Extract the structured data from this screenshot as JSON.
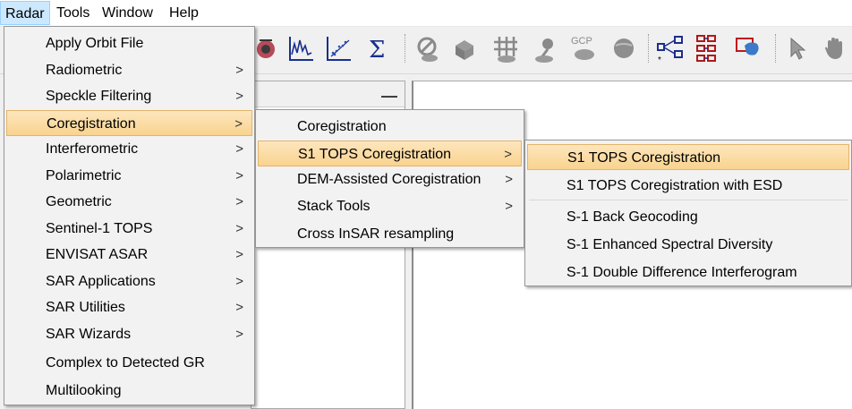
{
  "menubar": {
    "items": [
      {
        "label": "Radar"
      },
      {
        "label": "Tools"
      },
      {
        "label": "Window"
      },
      {
        "label": "Help"
      }
    ]
  },
  "toolbar": {
    "gcp_text": "GCP",
    "tools": [
      "radar-sat-icon",
      "spectrum-plot-icon",
      "scatter-plot-icon",
      "sum-icon",
      "no-entry-icon",
      "cube-open-icon",
      "grid-icon",
      "pin-icon",
      "gcp-icon",
      "globe-icon",
      "graph-builder-icon",
      "batch-processing-icon",
      "world-map-icon",
      "pointer-icon",
      "pan-hand-icon"
    ]
  },
  "radar_menu": {
    "items": [
      {
        "label": "Apply Orbit File",
        "submenu": false
      },
      {
        "label": "Radiometric",
        "submenu": true
      },
      {
        "label": "Speckle Filtering",
        "submenu": true
      },
      {
        "label": "Coregistration",
        "submenu": true
      },
      {
        "label": "Interferometric",
        "submenu": true
      },
      {
        "label": "Polarimetric",
        "submenu": true
      },
      {
        "label": "Geometric",
        "submenu": true
      },
      {
        "label": "Sentinel-1 TOPS",
        "submenu": true
      },
      {
        "label": "ENVISAT ASAR",
        "submenu": true
      },
      {
        "label": "SAR Applications",
        "submenu": true
      },
      {
        "label": "SAR Utilities",
        "submenu": true
      },
      {
        "label": "SAR Wizards",
        "submenu": true
      },
      {
        "label": "Complex to Detected GR",
        "submenu": false
      },
      {
        "label": "Multilooking",
        "submenu": false
      }
    ]
  },
  "coreg_menu": {
    "items": [
      {
        "label": "Coregistration",
        "submenu": false
      },
      {
        "label": "S1 TOPS Coregistration",
        "submenu": true
      },
      {
        "label": "DEM-Assisted Coregistration",
        "submenu": true
      },
      {
        "label": "Stack Tools",
        "submenu": true
      },
      {
        "label": "Cross InSAR resampling",
        "submenu": false
      }
    ]
  },
  "s1tops_menu": {
    "items": [
      {
        "label": "S1 TOPS Coregistration"
      },
      {
        "label": "S1 TOPS Coregistration with ESD"
      },
      {
        "label": "S-1 Back Geocoding"
      },
      {
        "label": "S-1 Enhanced Spectral Diversity"
      },
      {
        "label": "S-1 Double Difference Interferogram"
      }
    ]
  },
  "arrow_glyph": ">",
  "minimize_glyph": "—"
}
